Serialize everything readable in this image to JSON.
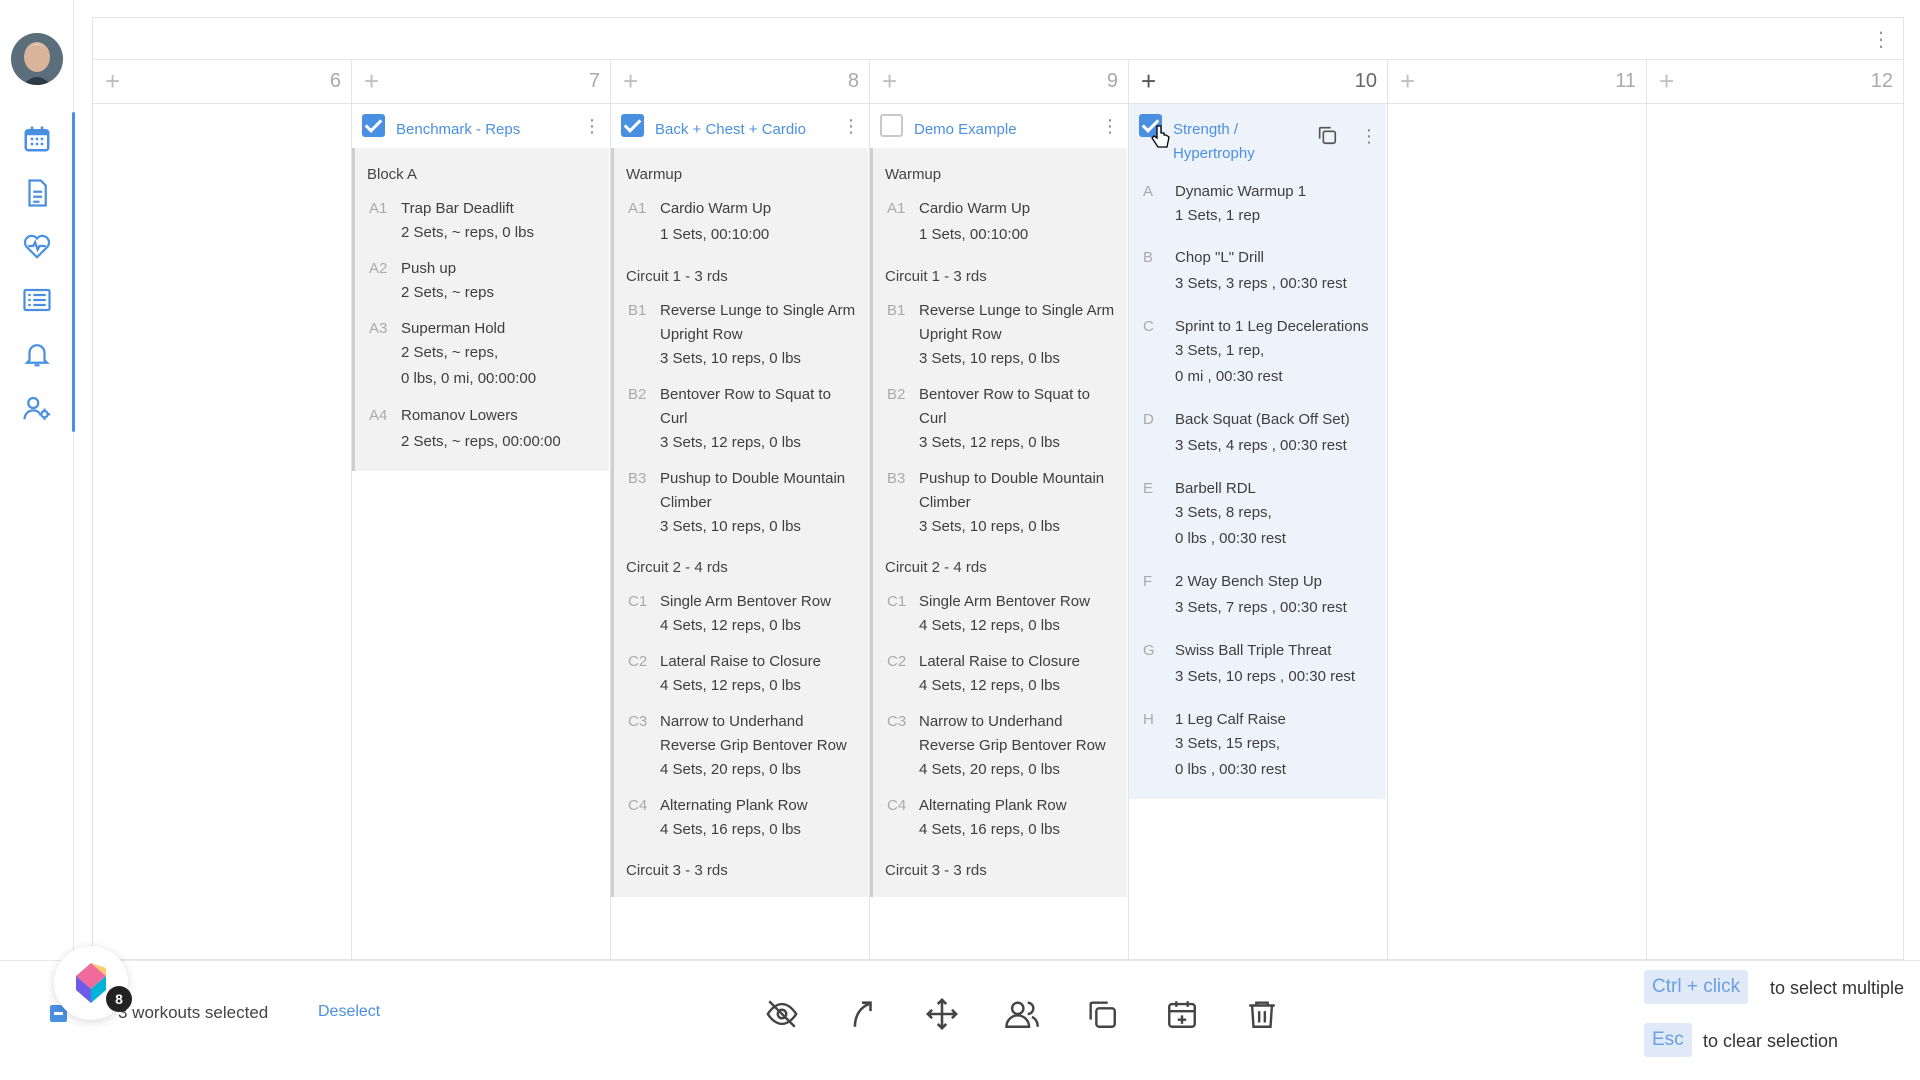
{
  "calendar": {
    "days": [
      {
        "num": "6"
      },
      {
        "num": "7"
      },
      {
        "num": "8"
      },
      {
        "num": "9"
      },
      {
        "num": "10"
      },
      {
        "num": "11"
      },
      {
        "num": "12"
      }
    ]
  },
  "workouts": {
    "benchmark": {
      "title": "Benchmark - Reps",
      "selected": true,
      "section1": "Block A",
      "exercises": [
        {
          "code": "A1",
          "name": "Trap Bar Deadlift",
          "d1": "2 Sets, ~ reps, 0 lbs",
          "d2": ""
        },
        {
          "code": "A2",
          "name": "Push up",
          "d1": "2 Sets, ~ reps",
          "d2": ""
        },
        {
          "code": "A3",
          "name": "Superman Hold",
          "d1": "2 Sets, ~ reps,",
          "d2": "0 lbs, 0 mi, 00:00:00"
        },
        {
          "code": "A4",
          "name": "Romanov Lowers",
          "d1": "2 Sets, ~ reps, 00:00:00",
          "d2": ""
        }
      ]
    },
    "back_chest": {
      "title": "Back + Chest + Cardio",
      "selected": true,
      "warmup": "Warmup",
      "a1": {
        "code": "A1",
        "name": "Cardio Warm Up",
        "d1": "1 Sets, 00:10:00"
      },
      "circuit1": "Circuit 1 - 3 rds",
      "b1": {
        "code": "B1",
        "name": "Reverse Lunge to Single Arm Upright Row",
        "d1": "3 Sets, 10 reps, 0 lbs"
      },
      "b2": {
        "code": "B2",
        "name": "Bentover Row to Squat to Curl",
        "d1": "3 Sets, 12 reps, 0 lbs"
      },
      "b3": {
        "code": "B3",
        "name": "Pushup to Double Mountain Climber",
        "d1": "3 Sets, 10 reps, 0 lbs"
      },
      "circuit2": "Circuit 2 - 4 rds",
      "c1": {
        "code": "C1",
        "name": "Single Arm Bentover Row",
        "d1": "4 Sets, 12 reps, 0 lbs"
      },
      "c2": {
        "code": "C2",
        "name": "Lateral Raise to Closure",
        "d1": "4 Sets, 12 reps, 0 lbs"
      },
      "c3": {
        "code": "C3",
        "name": "Narrow to Underhand Reverse Grip Bentover Row",
        "d1": "4 Sets, 20 reps, 0 lbs"
      },
      "c4": {
        "code": "C4",
        "name": "Alternating Plank Row",
        "d1": "4 Sets, 16 reps, 0 lbs"
      },
      "circuit3": "Circuit 3 - 3 rds"
    },
    "demo": {
      "title": "Demo Example",
      "selected": false
    },
    "strength": {
      "title": "Strength / Hypertrophy",
      "selected": true,
      "exercises": [
        {
          "code": "A",
          "name": "Dynamic Warmup 1",
          "d1": "1 Sets, 1 rep",
          "d2": ""
        },
        {
          "code": "B",
          "name": "Chop \"L\" Drill",
          "d1": "3 Sets, 3 reps , 00:30 rest",
          "d2": ""
        },
        {
          "code": "C",
          "name": "Sprint to 1 Leg Decelerations",
          "d1": "3 Sets, 1 rep,",
          "d2": "0 mi , 00:30 rest"
        },
        {
          "code": "D",
          "name": "Back Squat (Back Off Set)",
          "d1": "3 Sets, 4 reps , 00:30 rest",
          "d2": ""
        },
        {
          "code": "E",
          "name": "Barbell RDL",
          "d1": "3 Sets, 8 reps,",
          "d2": "0 lbs , 00:30 rest"
        },
        {
          "code": "F",
          "name": "2 Way Bench Step Up",
          "d1": "3 Sets, 7 reps , 00:30 rest",
          "d2": ""
        },
        {
          "code": "G",
          "name": "Swiss Ball Triple Threat",
          "d1": "3 Sets, 10 reps , 00:30 rest",
          "d2": ""
        },
        {
          "code": "H",
          "name": "1 Leg Calf Raise",
          "d1": "3 Sets, 15 reps,",
          "d2": "0 lbs , 00:30 rest"
        }
      ]
    }
  },
  "bottom": {
    "selected_text": "3 workouts selected",
    "deselect": "Deselect",
    "badge_count": "8",
    "kbd1": "Ctrl + click",
    "kbd1_desc": "to select multiple",
    "kbd2": "Esc",
    "kbd2_desc": "to clear selection"
  },
  "colors": {
    "accent": "#4a90e2",
    "card_bg": "#f2f2f2",
    "selected_card_bg": "#eef2fb"
  },
  "icons": {
    "sidebar": [
      "calendar-icon",
      "document-icon",
      "heart-pulse-icon",
      "list-icon",
      "bell-icon",
      "user-settings-icon"
    ],
    "toolbar": [
      "hide-icon",
      "share-icon",
      "move-icon",
      "assign-users-icon",
      "copy-icon",
      "calendar-add-icon",
      "trash-icon"
    ]
  }
}
